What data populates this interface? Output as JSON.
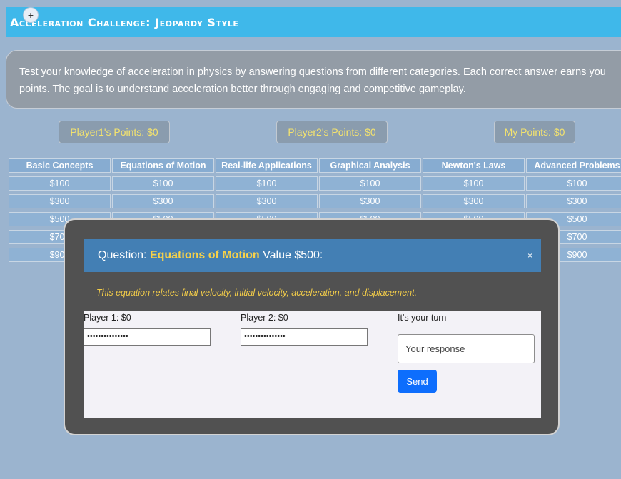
{
  "header": {
    "title": "Acceleration Challenge: Jeopardy Style",
    "zoom_icon": "+"
  },
  "intro": "Test your knowledge of acceleration in physics by answering questions from different categories. Each correct answer earns you points. The goal is to understand acceleration better through engaging and competitive gameplay.",
  "scoreboard": {
    "player1": "Player1's Points: $0",
    "player2": "Player2's Points: $0",
    "me": "My Points: $0"
  },
  "board": {
    "categories": [
      "Basic Concepts",
      "Equations of Motion",
      "Real-life Applications",
      "Graphical Analysis",
      "Newton's Laws",
      "Advanced Problems"
    ],
    "values": [
      "$100",
      "$300",
      "$500",
      "$700",
      "$900"
    ]
  },
  "modal": {
    "question_prefix": "Question: ",
    "category": "Equations of Motion",
    "value_text": " Value $500:",
    "close_label": "×",
    "clue": "This equation relates final velocity, initial velocity, acceleration, and displacement.",
    "player1_label": "Player 1: $0",
    "player1_value": "•••••••••••••••",
    "player2_label": "Player 2: $0",
    "player2_value": "•••••••••••••••",
    "turn_label": "It's your turn",
    "response_placeholder": "Your response",
    "send_label": "Send"
  }
}
